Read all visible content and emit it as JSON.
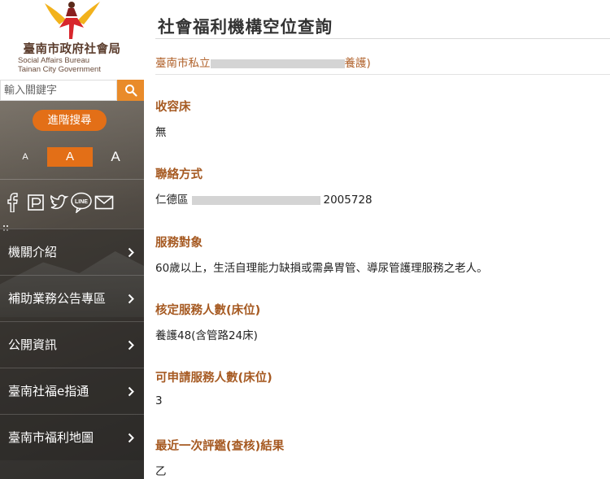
{
  "sidebar": {
    "logo": {
      "title": "臺南市政府社會局",
      "english_line1": "Social Affairs Bureau",
      "english_line2": "Tainan City Government"
    },
    "search": {
      "placeholder": "輸入關鍵字",
      "icon": "search-icon"
    },
    "advanced_search_label": "進階搜尋",
    "font_sizes": [
      "A",
      "A",
      "A"
    ],
    "social_icons": [
      "facebook-icon",
      "plurk-icon",
      "twitter-icon",
      "line-icon",
      "email-icon"
    ],
    "nav_items": [
      {
        "label": "機關介紹"
      },
      {
        "label": "補助業務公告專區"
      },
      {
        "label": "公開資訊"
      },
      {
        "label": "臺南社福e指通"
      },
      {
        "label": "臺南市福利地圖"
      }
    ]
  },
  "main": {
    "title": "社會福利機構空位查詢",
    "org_name_prefix": "臺南市私立",
    "org_name_suffix": "養護)",
    "fields": [
      {
        "label": "收容床",
        "value": "無"
      },
      {
        "label": "聯絡方式",
        "value_prefix": "仁德區",
        "value_suffix": "2005728"
      },
      {
        "label": "服務對象",
        "value": "60歲以上，生活自理能力缺損或需鼻胃管、導尿管護理服務之老人。"
      },
      {
        "label": "核定服務人數(床位)",
        "value": "養護48(含管路24床)"
      },
      {
        "label": "可申請服務人數(床位)",
        "value": "3"
      },
      {
        "label": "最近一次評鑑(查核)結果",
        "value": "乙"
      }
    ]
  },
  "colors": {
    "accent_orange": "#e36f17",
    "label_brown": "#a65a22",
    "org_name_brown": "#b0612a"
  }
}
